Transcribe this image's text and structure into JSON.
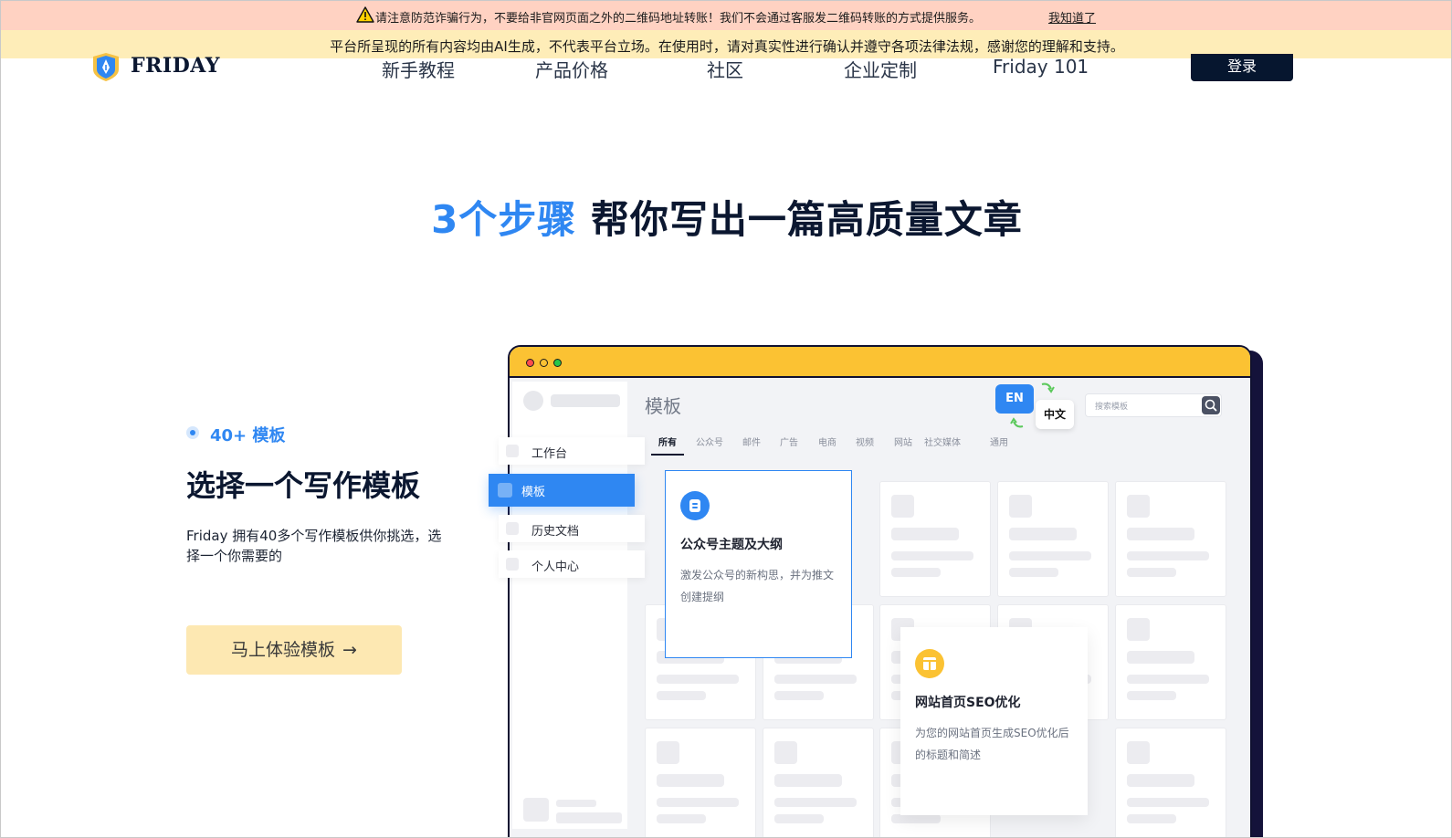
{
  "notice": {
    "warning_text": "请注意防范诈骗行为，不要给非官网页面之外的二维码地址转账！我们不会通过客服发二维码转账的方式提供服务。",
    "warning_dismiss": "我知道了",
    "info_text": "平台所呈现的所有内容均由AI生成，不代表平台立场。在使用时，请对真实性进行确认并遵守各项法律法规，感谢您的理解和支持。"
  },
  "nav": {
    "brand": "FRIDAY",
    "links": [
      "新手教程",
      "产品价格",
      "社区",
      "企业定制",
      "Friday 101"
    ],
    "login": "登录"
  },
  "headline": {
    "highlight": "3个步骤",
    "rest": "帮你写出一篇高质量文章"
  },
  "step": {
    "badge": "40+ 模板",
    "title": "选择一个写作模板",
    "description": "Friday 拥有40多个写作模板供你挑选，选择一个你需要的",
    "cta": "马上体验模板",
    "cta_arrow": "→"
  },
  "mockup": {
    "main_title": "模板",
    "menu": [
      "工作台",
      "模板",
      "历史文档",
      "个人中心"
    ],
    "active_menu": "模板",
    "tabs": [
      "所有",
      "公众号",
      "邮件",
      "广告",
      "电商",
      "视频",
      "网站",
      "社交媒体",
      "通用"
    ],
    "active_tab": "所有",
    "lang_en": "EN",
    "lang_zh": "中文",
    "search_placeholder": "搜索模板",
    "card_wechat": {
      "title": "公众号主题及大纲",
      "description": "激发公众号的新构思，并为推文创建提纲",
      "icon": "blog-b-icon",
      "icon_color": "#2f87f2"
    },
    "card_seo": {
      "title": "网站首页SEO优化",
      "description": "为您的网站首页生成SEO优化后的标题和简述",
      "icon": "webpage-icon",
      "icon_color": "#fbc233"
    }
  },
  "colors": {
    "accent_blue": "#2f87f2",
    "dark_navy": "#0b1730",
    "warning_bg": "#ffd2c2",
    "info_bg": "#feedb8",
    "cta_bg": "#fde8b2",
    "window_bar": "#fbc233"
  }
}
